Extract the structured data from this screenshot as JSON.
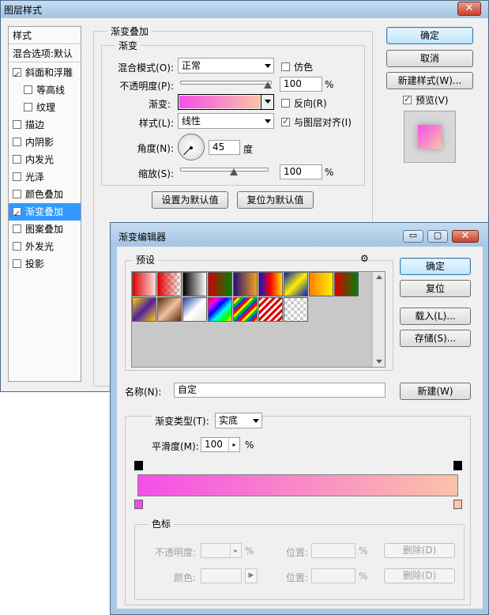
{
  "layer_style": {
    "title": "图层样式",
    "close": "✕",
    "list_header_styles": "样式",
    "list_header_blend": "混合选项:默认",
    "items": [
      {
        "label": "斜面和浮雕",
        "checked": true
      },
      {
        "label": "等高线",
        "checked": false
      },
      {
        "label": "纹理",
        "checked": false
      },
      {
        "label": "描边",
        "checked": false
      },
      {
        "label": "内阴影",
        "checked": false
      },
      {
        "label": "内发光",
        "checked": false
      },
      {
        "label": "光泽",
        "checked": false
      },
      {
        "label": "颜色叠加",
        "checked": false
      },
      {
        "label": "渐变叠加",
        "checked": true
      },
      {
        "label": "图案叠加",
        "checked": false
      },
      {
        "label": "外发光",
        "checked": false
      },
      {
        "label": "投影",
        "checked": false
      }
    ],
    "section_title": "渐变叠加",
    "subsection_title": "渐变",
    "blend_mode_label": "混合模式(O):",
    "blend_mode_value": "正常",
    "dither_label": "仿色",
    "opacity_label": "不透明度(P):",
    "opacity_value": "100",
    "percent": "%",
    "gradient_label": "渐变:",
    "reverse_label": "反向(R)",
    "style_label": "样式(L):",
    "style_value": "线性",
    "align_label": "与图层对齐(I)",
    "angle_label": "角度(N):",
    "angle_value": "45",
    "degree": "度",
    "scale_label": "缩放(S):",
    "scale_value": "100",
    "btn_set_default": "设置为默认值",
    "btn_reset_default": "复位为默认值",
    "btn_ok": "确定",
    "btn_cancel": "取消",
    "btn_new_style": "新建样式(W)...",
    "preview_label": "预览(V)",
    "gradient_start": "#f54ee8",
    "gradient_end": "#fbc3a7"
  },
  "gradient_editor": {
    "title": "渐变编辑器",
    "presets_label": "预设",
    "gear": "⚙",
    "btn_ok": "确定",
    "btn_reset": "复位",
    "btn_load": "载入(L)...",
    "btn_save": "存储(S)...",
    "name_label": "名称(N):",
    "name_value": "自定",
    "btn_new": "新建(W)",
    "type_label": "渐变类型(T):",
    "type_value": "实底",
    "smooth_label": "平滑度(M):",
    "smooth_value": "100",
    "percent": "%",
    "stops_label": "色标",
    "opacity_label": "不透明度:",
    "location_label": "位置:",
    "delete_label": "删除(D)",
    "color_label": "颜色:",
    "win_min": "▭",
    "win_max": "▢",
    "win_close": "✕"
  }
}
